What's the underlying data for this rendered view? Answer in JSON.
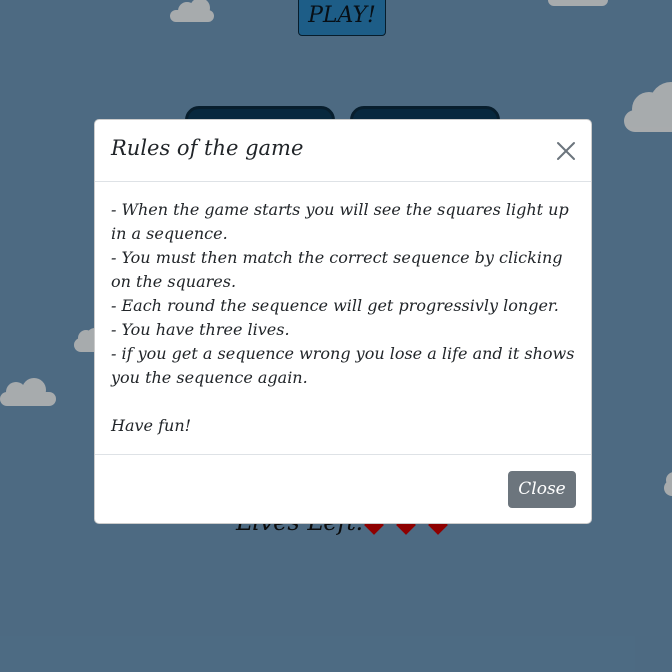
{
  "game": {
    "play_label": "PLAY!",
    "lives_label": "Lives Left:",
    "lives": 3
  },
  "modal": {
    "title": "Rules of the game",
    "close_icon": "close-icon",
    "rules": [
      "- When the game starts you will see the squares light up in a sequence.",
      "- You must then match the correct sequence by clicking on the squares.",
      "- Each round the sequence will get progressivly longer.",
      "- You have three lives.",
      "- if you get a sequence wrong you lose a life and it shows you the sequence again."
    ],
    "closing": "Have fun!",
    "close_button_label": "Close"
  },
  "colors": {
    "background": "#6f99bb",
    "play_button": "#2a86c2",
    "square": "#0c3a59",
    "heart": "#cc0000",
    "close_button": "#6c757d"
  }
}
